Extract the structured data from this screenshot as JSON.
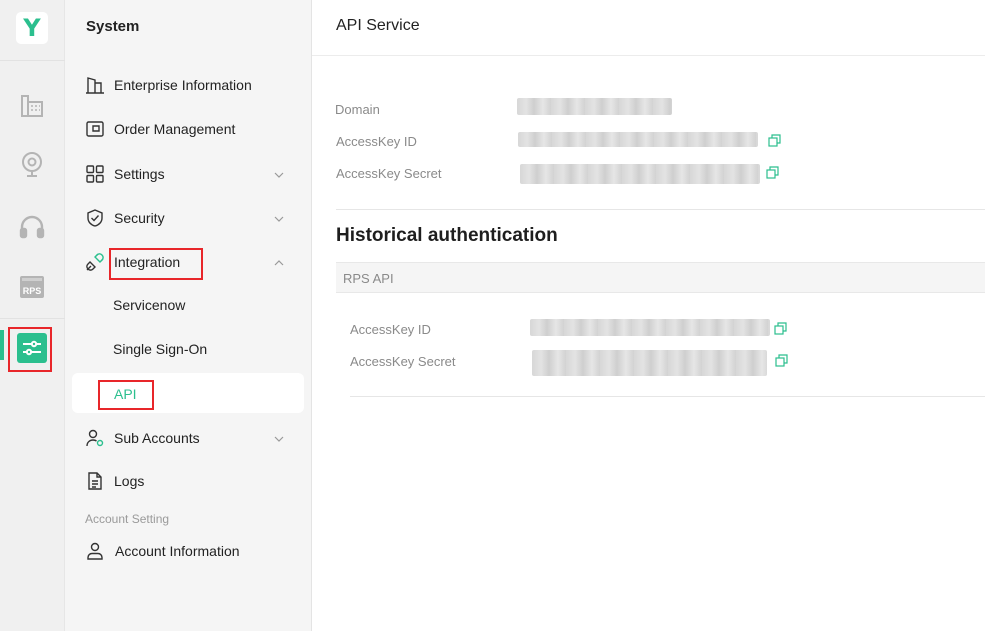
{
  "rail": {
    "logo_text": "Y",
    "icons": [
      "building-grid-icon",
      "webcam-icon",
      "headset-icon",
      "rps-icon",
      "settings-sliders-icon"
    ],
    "rps_label": "RPS",
    "active_color": "#2bbf8e"
  },
  "sidebar": {
    "title": "System",
    "items": [
      {
        "label": "Enterprise Information",
        "icon": "building-icon"
      },
      {
        "label": "Order Management",
        "icon": "wallet-icon"
      },
      {
        "label": "Settings",
        "icon": "grid-icon",
        "expandable": true
      },
      {
        "label": "Security",
        "icon": "shield-icon",
        "expandable": true
      },
      {
        "label": "Integration",
        "icon": "plug-icon",
        "expanded": true
      },
      {
        "label": "Sub Accounts",
        "icon": "user-gear-icon",
        "expandable": true
      },
      {
        "label": "Logs",
        "icon": "document-icon"
      }
    ],
    "integration_subitems": [
      "Servicenow",
      "Single Sign-On",
      "API"
    ],
    "active_subitem": "API",
    "section_label": "Account Setting",
    "account_item": {
      "label": "Account Information",
      "icon": "user-icon"
    }
  },
  "main": {
    "title": "API Service",
    "fields": {
      "domain_label": "Domain",
      "key_id_label": "AccessKey ID",
      "key_secret_label": "AccessKey Secret"
    },
    "history_title": "Historical authentication",
    "panel": {
      "title": "RPS API",
      "key_id_label": "AccessKey ID",
      "key_secret_label": "AccessKey Secret"
    }
  },
  "colors": {
    "accent": "#2bbf8e",
    "highlight": "#e8262a"
  }
}
